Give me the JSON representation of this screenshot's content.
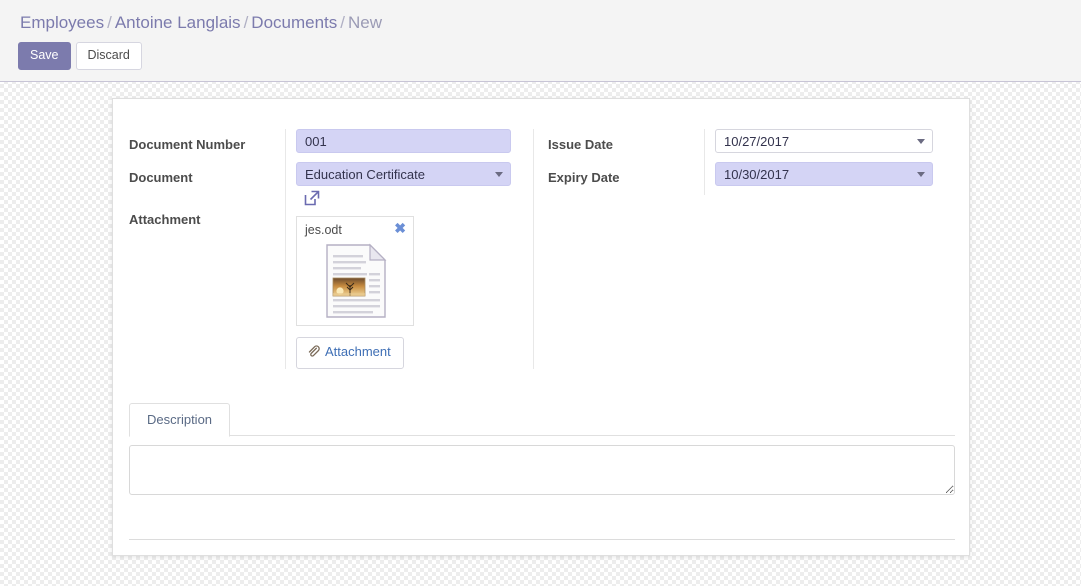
{
  "breadcrumb": {
    "items": [
      {
        "label": "Employees",
        "active": false
      },
      {
        "label": "Antoine Langlais",
        "active": false
      },
      {
        "label": "Documents",
        "active": false
      },
      {
        "label": "New",
        "active": true
      }
    ],
    "separator": "/"
  },
  "toolbar": {
    "save_label": "Save",
    "discard_label": "Discard"
  },
  "form": {
    "fields": {
      "document_number": {
        "label": "Document Number",
        "value": "001",
        "placeholder": ""
      },
      "document": {
        "label": "Document",
        "value": "Education Certificate",
        "external_link_icon": "external-link-icon",
        "dropdown_icon": "chevron-down-icon"
      },
      "attachment": {
        "label": "Attachment",
        "file_name": "jes.odt",
        "remove_icon": "close-icon",
        "thumbnail_icon": "document-file-icon",
        "add_button_label": "Attachment",
        "add_button_icon": "paperclip-icon"
      },
      "issue_date": {
        "label": "Issue Date",
        "value": "10/27/2017",
        "dropdown_icon": "chevron-down-icon"
      },
      "expiry_date": {
        "label": "Expiry Date",
        "value": "10/30/2017",
        "dropdown_icon": "chevron-down-icon"
      }
    }
  },
  "notebook": {
    "tabs": [
      {
        "label": "Description",
        "active": true
      }
    ],
    "description": {
      "value": "",
      "placeholder": ""
    }
  },
  "colors": {
    "accent": "#7c7bad",
    "field_highlight": "#d4d4f5",
    "breadcrumb_link": "#7c7bad",
    "breadcrumb_active": "#9b9bb5",
    "link_text": "#3f6fb5",
    "panel_bg": "#f4f4f4"
  }
}
